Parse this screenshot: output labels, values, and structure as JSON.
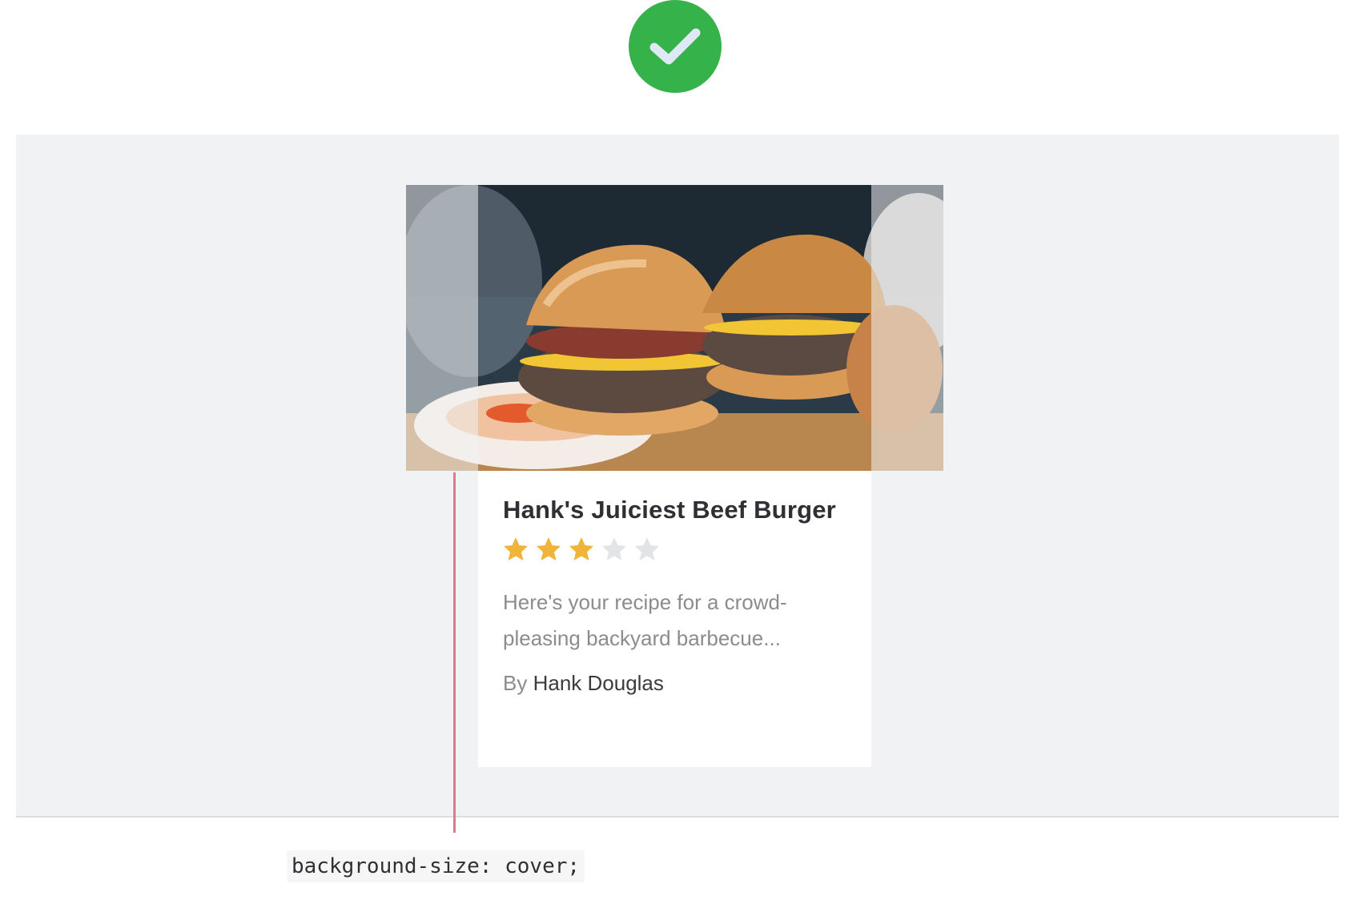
{
  "status": {
    "icon": "checkmark-icon",
    "color": "#36b24a"
  },
  "card": {
    "image": {
      "icon": "burger-photo",
      "subject": "burgers"
    },
    "title": "Hank's Juiciest Beef Burger",
    "rating": {
      "value": 3,
      "max": 5
    },
    "description": "Here's your recipe for a crowd-pleasing backyard barbecue...",
    "byline": {
      "prefix": "By",
      "author": "Hank Douglas"
    }
  },
  "annotation": {
    "code": "background-size: cover;",
    "marker_color": "#e0798c"
  },
  "colors": {
    "panel": "#f1f2f4",
    "star_filled": "#f0b43a",
    "star_empty": "#e3e4e6"
  }
}
